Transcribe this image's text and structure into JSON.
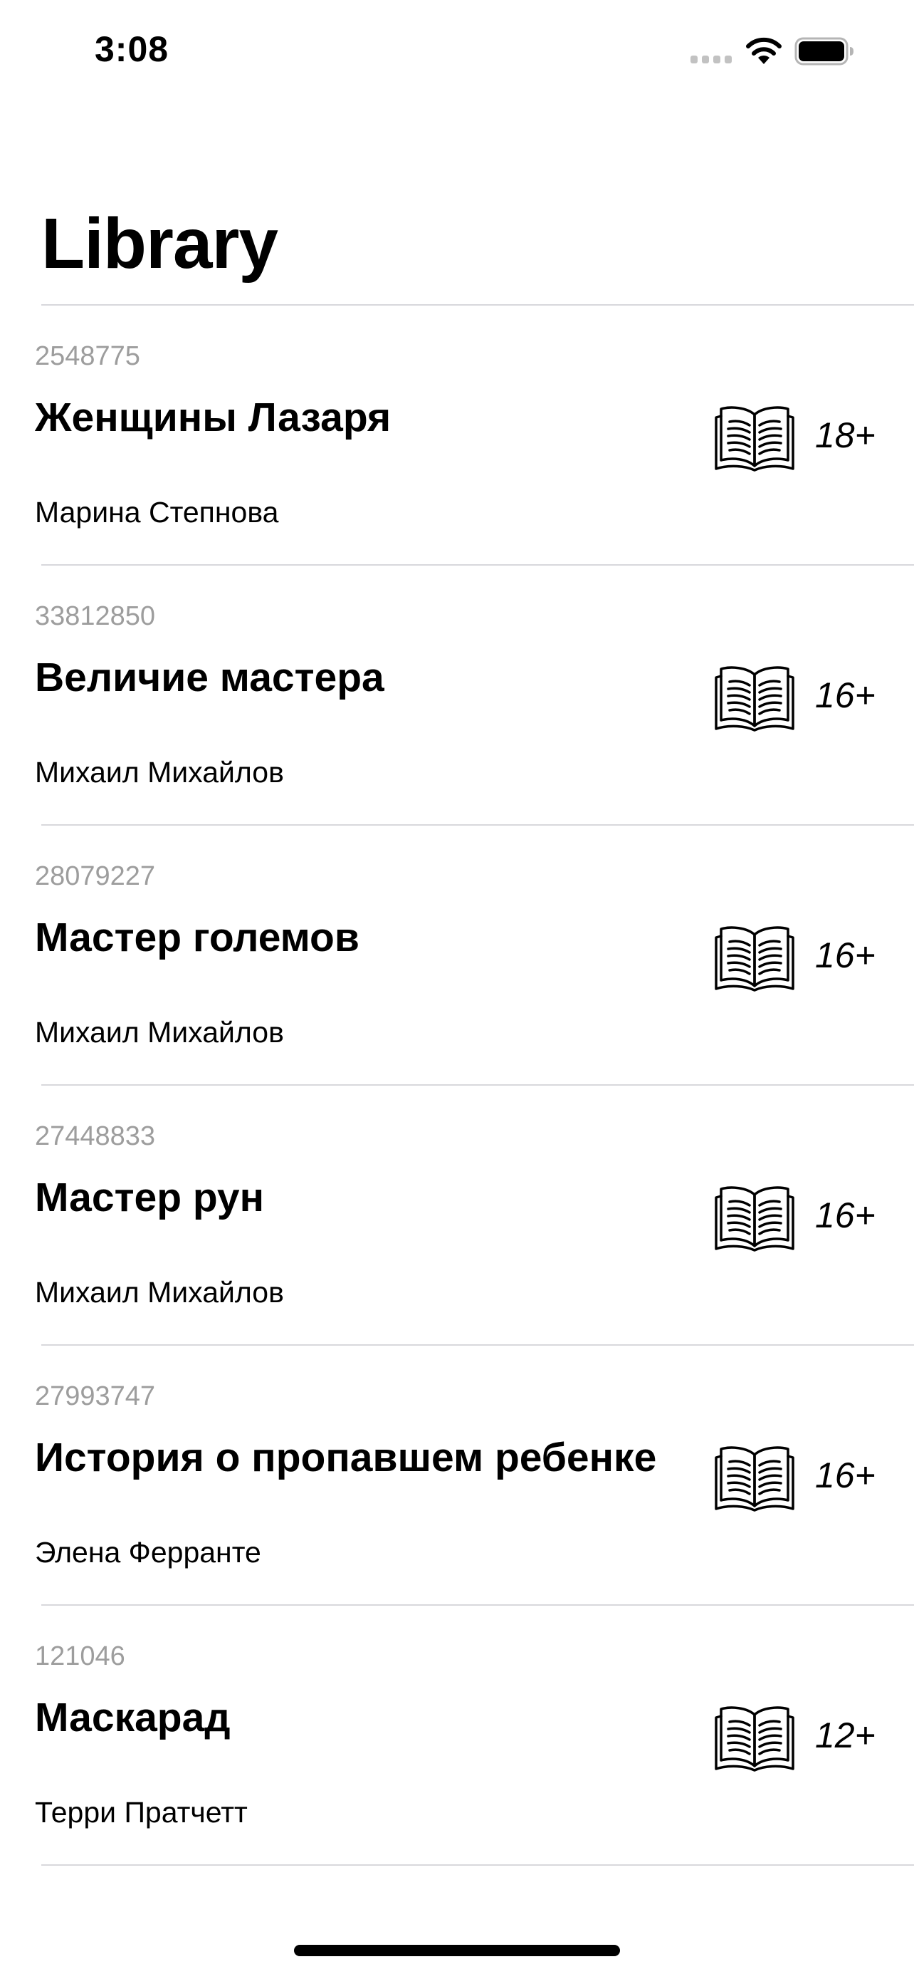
{
  "status_bar": {
    "time": "3:08"
  },
  "header": {
    "title": "Library"
  },
  "books": [
    {
      "id": "2548775",
      "title": "Женщины Лазаря",
      "author": "Марина Степнова",
      "age_rating": "18+",
      "icon": "open-book-icon"
    },
    {
      "id": "33812850",
      "title": "Величие мастера",
      "author": "Михаил Михайлов",
      "age_rating": "16+",
      "icon": "open-book-icon"
    },
    {
      "id": "28079227",
      "title": "Мастер големов",
      "author": "Михаил Михайлов",
      "age_rating": "16+",
      "icon": "open-book-icon"
    },
    {
      "id": "27448833",
      "title": "Мастер рун",
      "author": "Михаил Михайлов",
      "age_rating": "16+",
      "icon": "open-book-icon"
    },
    {
      "id": "27993747",
      "title": "История о пропавшем ребенке",
      "author": "Элена Ферранте",
      "age_rating": "16+",
      "icon": "open-book-icon"
    },
    {
      "id": "121046",
      "title": "Маскарад",
      "author": "Терри Пратчетт",
      "age_rating": "12+",
      "icon": "open-book-icon"
    }
  ]
}
